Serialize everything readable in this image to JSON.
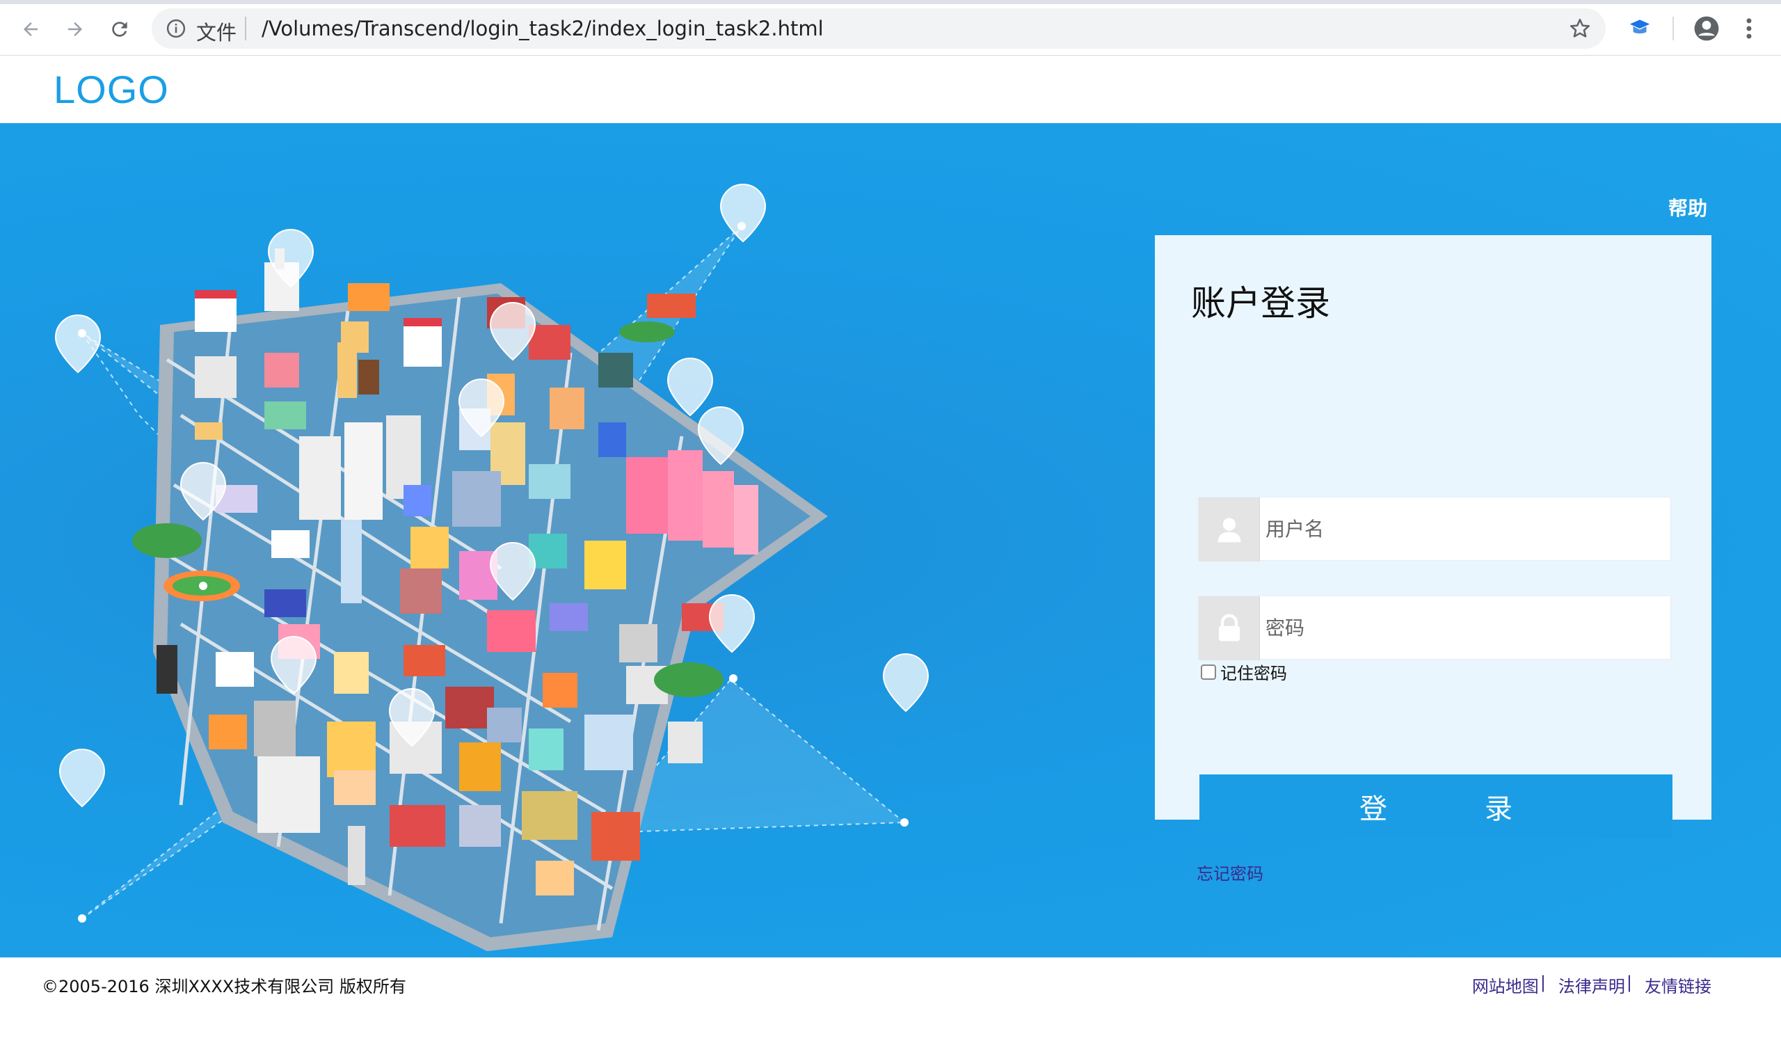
{
  "browser": {
    "file_label": "文件",
    "url": "/Volumes/Transcend/login_task2/index_login_task2.html"
  },
  "header": {
    "logo": "LOGO"
  },
  "hero": {
    "help_link": "帮助"
  },
  "login_panel": {
    "title": "账户登录",
    "username_placeholder": "用户名",
    "password_placeholder": "密码",
    "remember_label": "记住密码",
    "remember_checked": false,
    "login_button": "登录",
    "forgot_link": "忘记密码"
  },
  "footer": {
    "copyright": "©2005-2016 深圳XXXX技术有限公司 版权所有",
    "links": [
      "网站地图",
      "法律声明",
      "友情链接"
    ],
    "link_separator": "|"
  },
  "colors": {
    "brand_blue": "#1a9ce5",
    "panel_bg": "#eaf6fd",
    "link_purple": "#3b2a8c"
  },
  "icons": [
    "back-arrow-icon",
    "forward-arrow-icon",
    "reload-icon",
    "info-icon",
    "star-icon",
    "extension-icon",
    "profile-icon",
    "menu-icon",
    "user-icon",
    "lock-icon"
  ]
}
